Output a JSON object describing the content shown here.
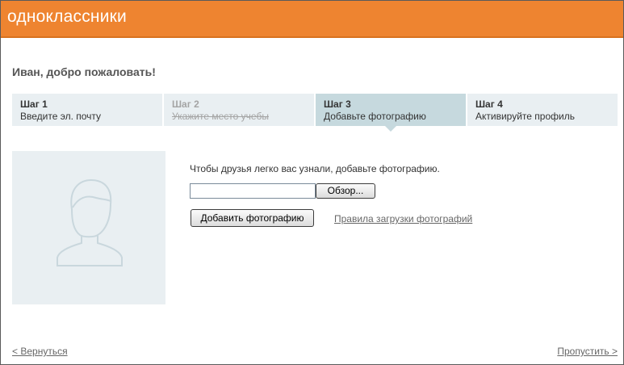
{
  "header": {
    "logo_text": "одноклассники",
    "background_color": "#ee8430"
  },
  "greeting": "Иван, добро пожаловать!",
  "steps": [
    {
      "number": "Шаг 1",
      "label": "Введите эл. почту",
      "state": "normal"
    },
    {
      "number": "Шаг 2",
      "label": "Укажите место учебы",
      "state": "done"
    },
    {
      "number": "Шаг 3",
      "label": "Добавьте фотографию",
      "state": "active"
    },
    {
      "number": "Шаг 4",
      "label": "Активируйте профиль",
      "state": "normal"
    }
  ],
  "photo": {
    "placeholder_icon": "user-silhouette-icon"
  },
  "upload": {
    "hint": "Чтобы друзья легко вас узнали, добавьте фотографию.",
    "file_value": "",
    "browse_label": "Обзор...",
    "add_label": "Добавить фотографию",
    "rules_link": "Правила загрузки фотографий"
  },
  "footer": {
    "back_link": "< Вернуться",
    "skip_link": "Пропустить >"
  },
  "colors": {
    "step_bg": "#e9eff2",
    "step_active_bg": "#c6d9de"
  }
}
